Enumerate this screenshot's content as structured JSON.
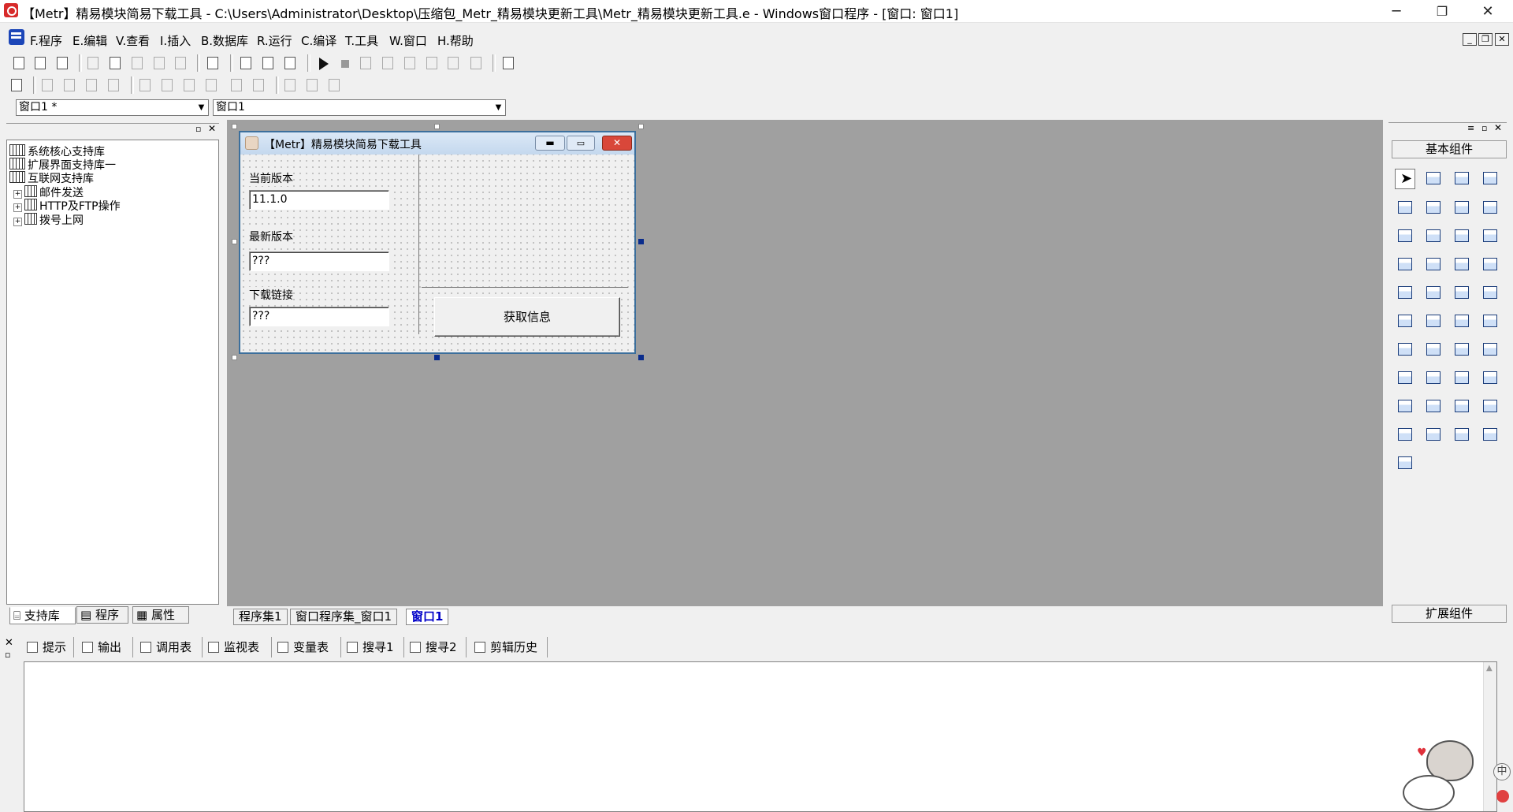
{
  "window": {
    "title": "【Metr】精易模块简易下载工具 - C:\\Users\\Administrator\\Desktop\\压缩包_Metr_精易模块更新工具\\Metr_精易模块更新工具.e - Windows窗口程序 - [窗口: 窗口1]",
    "minimize": "─",
    "restore": "❐",
    "close": "✕"
  },
  "menu": {
    "items": [
      "F.程序",
      "E.编辑",
      "V.查看",
      "I.插入",
      "B.数据库",
      "R.运行",
      "C.编译",
      "T.工具",
      "W.窗口",
      "H.帮助"
    ],
    "mdi_min": "_",
    "mdi_restore": "❐",
    "mdi_close": "✕"
  },
  "selectors": {
    "object_value": "窗口1 *",
    "event_value": "窗口1"
  },
  "left_panel": {
    "tree": [
      {
        "label": "系统核心支持库",
        "expandable": false
      },
      {
        "label": "扩展界面支持库一",
        "expandable": false
      },
      {
        "label": "互联网支持库",
        "expandable": false
      },
      {
        "label": "邮件发送",
        "expandable": true
      },
      {
        "label": "HTTP及FTP操作",
        "expandable": true
      },
      {
        "label": "拨号上网",
        "expandable": true
      }
    ],
    "tabs": [
      "支持库",
      "程序",
      "属性"
    ]
  },
  "designer": {
    "tabs": [
      "程序集1",
      "窗口程序集_窗口1",
      "窗口1"
    ],
    "form": {
      "title": "【Metr】精易模块简易下载工具",
      "label_current": "当前版本",
      "current_value": "11.1.0",
      "label_latest": "最新版本",
      "latest_value": "???",
      "label_link": "下载链接",
      "link_value": "???",
      "button": "获取信息"
    }
  },
  "right_panel": {
    "basic": "基本组件",
    "extended": "扩展组件"
  },
  "bottom": {
    "tabs": [
      "提示",
      "输出",
      "调用表",
      "监视表",
      "变量表",
      "搜寻1",
      "搜寻2",
      "剪辑历史"
    ]
  },
  "tray": {
    "ime": "中"
  }
}
